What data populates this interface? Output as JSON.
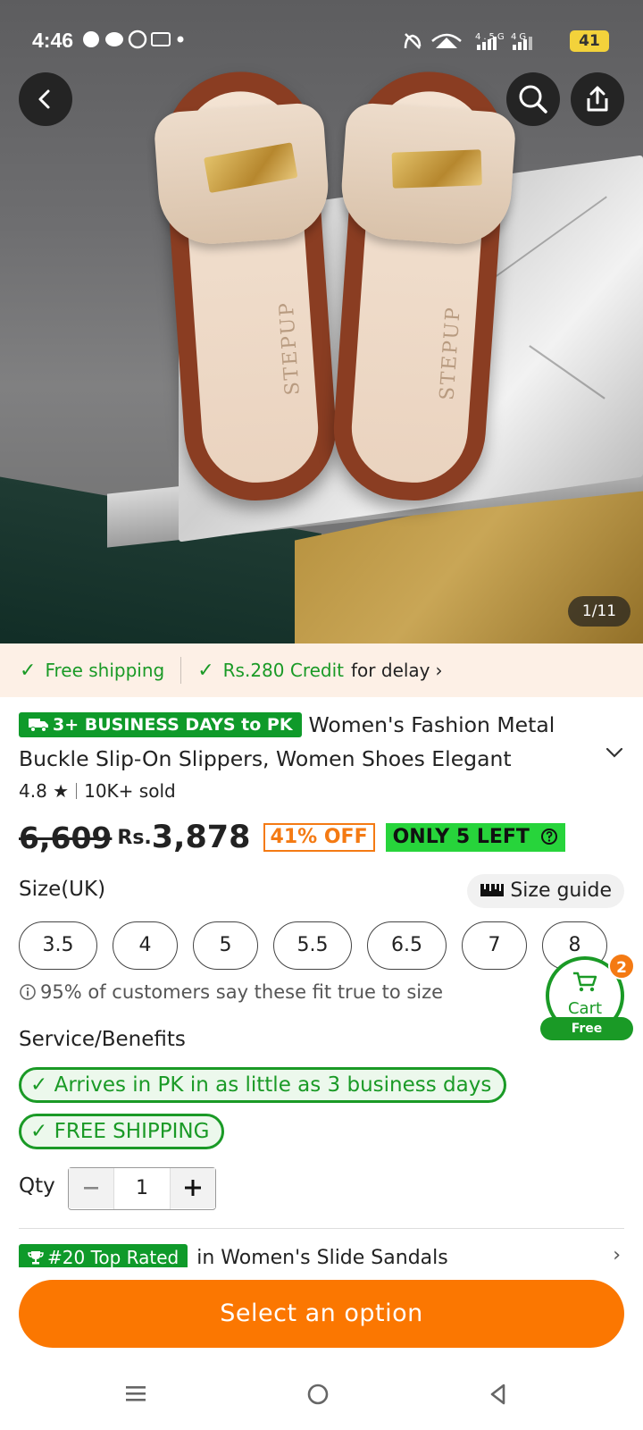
{
  "status_bar": {
    "time": "4:46",
    "left_icons": [
      "snapchat-icon",
      "chat-icon",
      "whatsapp-icon",
      "temu-icon",
      "dot-icon"
    ],
    "network_labels": [
      "4.5G",
      "4G"
    ],
    "battery": "41"
  },
  "hero": {
    "image_alt": "Women's slide slippers with gold buckle on marble block",
    "brand_imprint": "STEPUP",
    "counter": "1/11"
  },
  "shipping_bar": {
    "free_shipping": "Free shipping",
    "credit": "Rs.280 Credit",
    "credit_suffix": "for delay"
  },
  "product": {
    "delivery_badge": "3+ BUSINESS DAYS to PK",
    "title": "Women's Fashion Metal Buckle Slip-On Slippers, Women Shoes Elegant",
    "rating": "4.8",
    "sold": "10K+ sold",
    "old_price": "6,609",
    "currency": "Rs.",
    "price": "3,878",
    "discount": "41% OFF",
    "stock": "ONLY 5 LEFT"
  },
  "size": {
    "label": "Size(UK)",
    "guide": "Size guide",
    "options": [
      "3.5",
      "4",
      "5",
      "5.5",
      "6.5",
      "7",
      "8"
    ],
    "fit_note": "95% of customers say these fit true to size"
  },
  "cart": {
    "label": "Cart",
    "count": "2",
    "shipping": "Free shipping"
  },
  "service": {
    "label": "Service/Benefits",
    "benefits": [
      "Arrives in PK in as little as 3 business days",
      "FREE SHIPPING"
    ]
  },
  "quantity": {
    "label": "Qty",
    "value": "1"
  },
  "ranking": {
    "badge": "#20 Top Rated",
    "category": "in Women's Slide Sandals"
  },
  "cta": {
    "label": "Select an option"
  },
  "colors": {
    "accent_orange": "#fb7701",
    "green": "#1a9a26",
    "badge_green": "#0f9a2a",
    "stock_green": "#27d43b"
  }
}
